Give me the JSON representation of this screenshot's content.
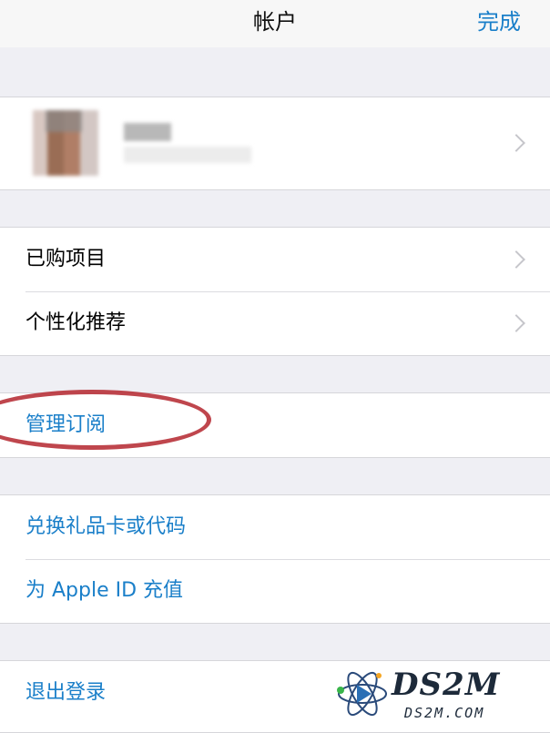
{
  "header": {
    "title": "帐户",
    "done_label": "完成"
  },
  "profile": {
    "avatar_icon": "blurred-avatar",
    "name": ""
  },
  "section_store": {
    "items": [
      {
        "label": "已购项目"
      },
      {
        "label": "个性化推荐"
      }
    ]
  },
  "section_subscriptions": {
    "items": [
      {
        "label": "管理订阅"
      }
    ]
  },
  "section_funds": {
    "items": [
      {
        "label": "兑换礼品卡或代码"
      },
      {
        "label": "为 Apple ID 充值"
      }
    ]
  },
  "section_signout": {
    "items": [
      {
        "label": "退出登录"
      }
    ]
  },
  "watermark": {
    "logo_text": "DS2M",
    "sub_text": "DS2M.COM"
  },
  "colors": {
    "accent": "#1a7fc9",
    "annotation": "#b8323a",
    "background": "#efeff4"
  }
}
